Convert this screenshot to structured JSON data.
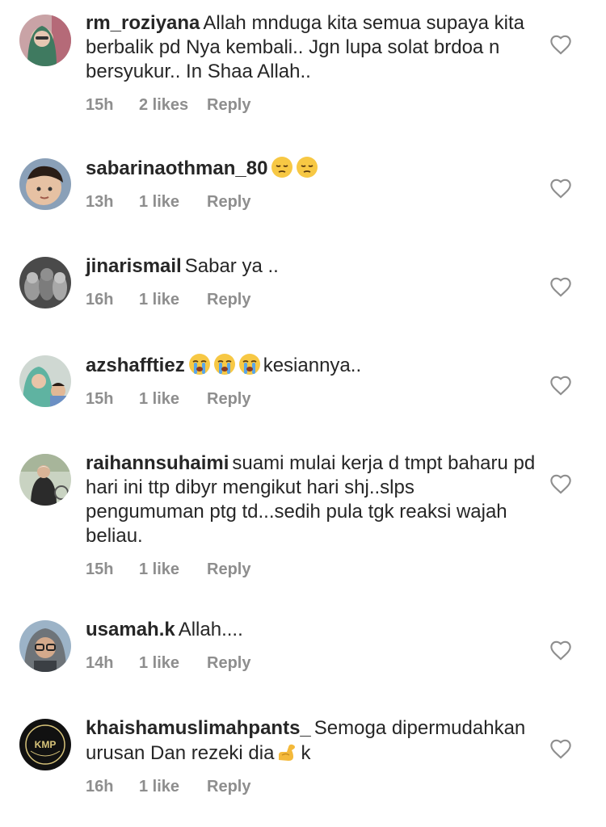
{
  "comments": [
    {
      "username": "rm_roziyana",
      "text": "Allah mnduga kita semua supaya kita berbalik pd Nya kembali.. Jgn lupa solat brdoa n bersyukur.. In Shaa Allah..",
      "emojis": [],
      "time": "15h",
      "likes": "2 likes",
      "reply": "Reply",
      "avatar": "woman-hijab-avatar"
    },
    {
      "username": "sabarinaothman_80",
      "text": "",
      "emojis": [
        "pensive-face-emoji",
        "pensive-face-emoji"
      ],
      "time": "13h",
      "likes": "1 like",
      "reply": "Reply",
      "avatar": "child-avatar"
    },
    {
      "username": "jinarismail",
      "text": "Sabar ya ..",
      "emojis": [],
      "time": "16h",
      "likes": "1 like",
      "reply": "Reply",
      "avatar": "cats-avatar"
    },
    {
      "username": "azshafftiez",
      "text": "kesiannya..",
      "emojis": [
        "crying-face-emoji",
        "crying-face-emoji",
        "crying-face-emoji"
      ],
      "time": "15h",
      "likes": "1 like",
      "reply": "Reply",
      "avatar": "family-avatar"
    },
    {
      "username": "raihannsuhaimi",
      "text": "suami mulai kerja d tmpt baharu pd hari ini ttp dibyr mengikut hari shj..slps pengumuman ptg td...sedih pula tgk reaksi wajah beliau.",
      "emojis": [],
      "time": "15h",
      "likes": "1 like",
      "reply": "Reply",
      "avatar": "woman-outdoor-avatar"
    },
    {
      "username": "usamah.k",
      "text": "Allah....",
      "emojis": [],
      "time": "14h",
      "likes": "1 like",
      "reply": "Reply",
      "avatar": "man-glasses-avatar"
    },
    {
      "username": "khaishamuslimahpants_",
      "text": "Semoga dipermudahkan urusan Dan rezeki dia",
      "emojis": [],
      "suffix_emoji": "flexed-biceps-emoji",
      "suffix_text": "k",
      "time": "16h",
      "likes": "1 like",
      "reply": "Reply",
      "avatar": "kmp-logo-avatar",
      "logo_text": "KMP"
    }
  ]
}
